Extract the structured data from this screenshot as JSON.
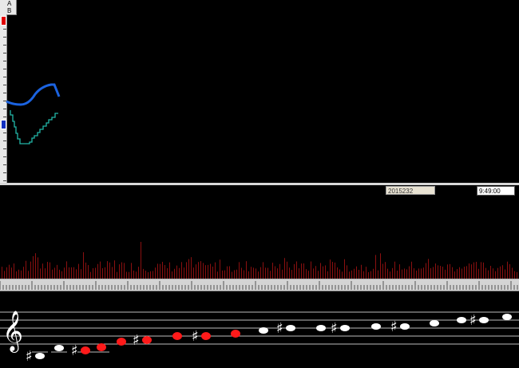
{
  "legend_box": {
    "label_a": "A",
    "label_b": "B"
  },
  "toolbar": {
    "date_value": "2015232",
    "time_value": "9:49:00"
  },
  "colors": {
    "background": "#000000",
    "price_line": "#1b63e0",
    "step_line": "#22b7a8",
    "volume_bars": "#8b1010",
    "note_red": "#ff1a1a",
    "note_white": "#ffffff",
    "staff_lines": "#bbbbbb"
  },
  "icons": {
    "clef": "treble-clef-icon",
    "sharp": "sharp-icon"
  },
  "clef_glyph": "𝄞",
  "sharp_glyph": "♯"
}
